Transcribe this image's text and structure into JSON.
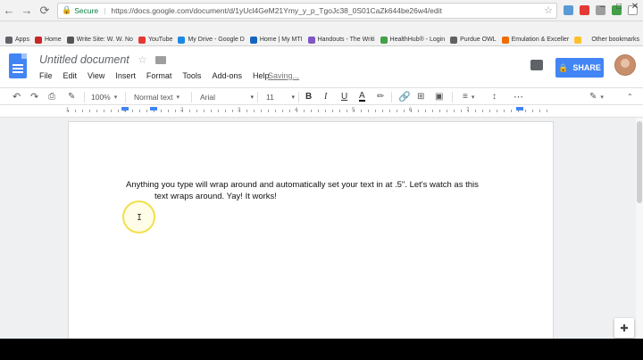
{
  "browser": {
    "url_security": "Secure",
    "url": "https://docs.google.com/document/d/1yUcl4GeM21Ymy_y_p_TgoJc38_0S01CaZk644be26w4/edit"
  },
  "bookmarks": [
    {
      "label": "Apps",
      "color": "#5f6368"
    },
    {
      "label": "Home",
      "color": "#c62828"
    },
    {
      "label": "Write Site: W. W. No",
      "color": "#555555"
    },
    {
      "label": "YouTube",
      "color": "#e53935"
    },
    {
      "label": "My Drive - Google D",
      "color": "#1e88e5"
    },
    {
      "label": "Home | My MTI",
      "color": "#1565c0"
    },
    {
      "label": "Handouts - The Writi",
      "color": "#7e57c2"
    },
    {
      "label": "HealthHub® - Login",
      "color": "#43a047"
    },
    {
      "label": "Purdue OWL",
      "color": "#616161"
    },
    {
      "label": "Emulation & Exceller",
      "color": "#ef6c00"
    },
    {
      "label": "",
      "color": "#fbc02d"
    }
  ],
  "other_bookmarks": "Other bookmarks",
  "docs": {
    "title": "Untitled document",
    "menu": [
      "File",
      "Edit",
      "View",
      "Insert",
      "Format",
      "Tools",
      "Add-ons",
      "Help"
    ],
    "status": "Saving...",
    "share_label": "SHARE"
  },
  "toolbar": {
    "zoom": "100%",
    "style": "Normal text",
    "font": "Arial",
    "size": "11"
  },
  "ruler_numbers": [
    "1",
    "1",
    "2",
    "3",
    "4",
    "5",
    "6",
    "7"
  ],
  "document": {
    "line1": "Anything you type will wrap around and automatically set your text in at .5\". Let's watch as this",
    "line2": "text wraps around. Yay! It works!"
  },
  "colors": {
    "accent": "#4285f4",
    "highlight_ring": "#f3df4a"
  }
}
